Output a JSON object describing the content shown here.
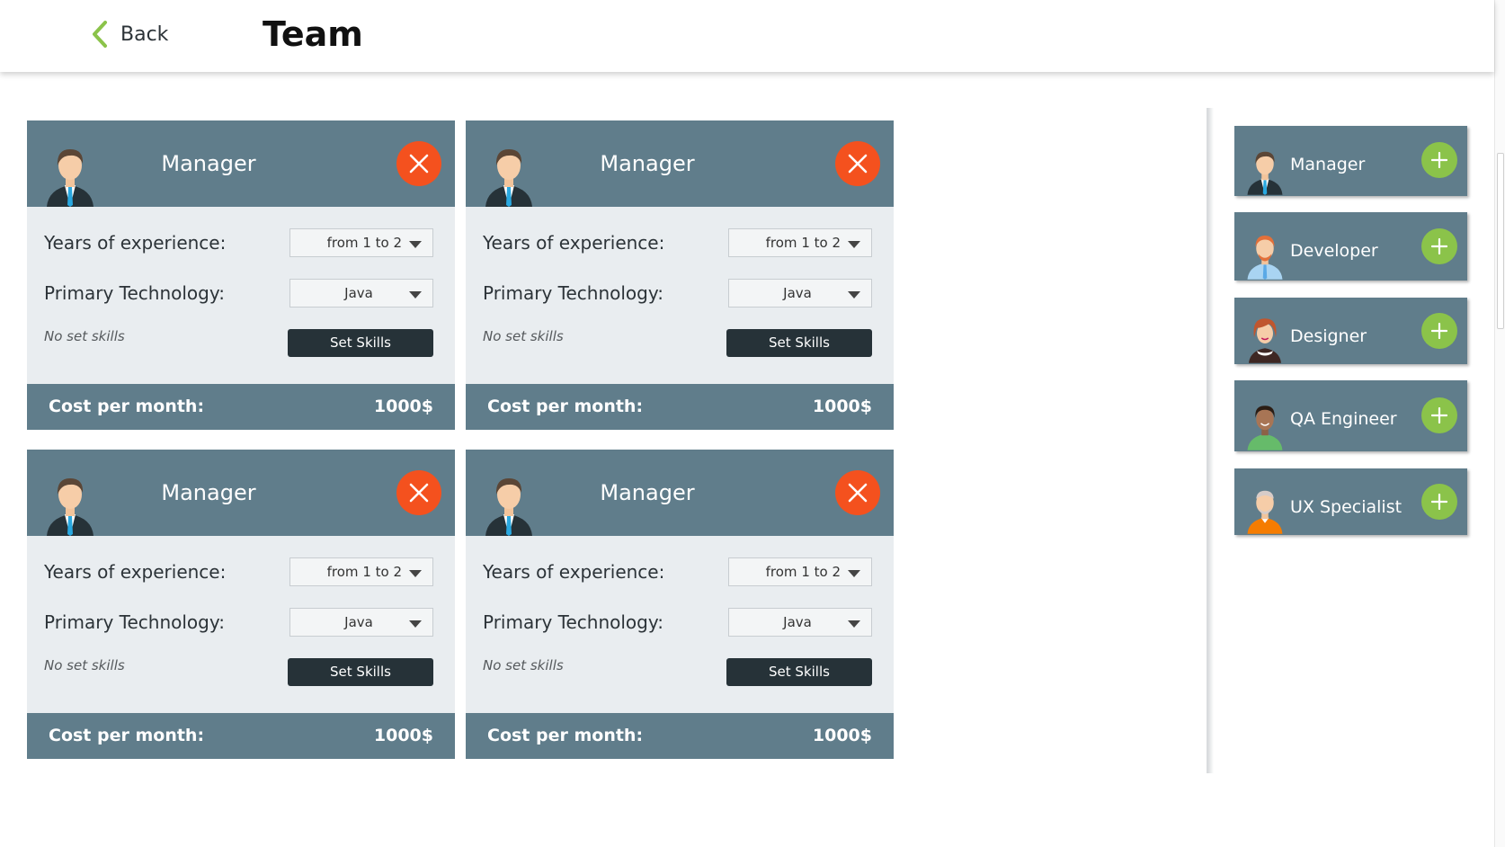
{
  "header": {
    "back_label": "Back",
    "title": "Team"
  },
  "labels": {
    "experience": "Years of experience:",
    "technology": "Primary Technology:",
    "no_skills": "No set skills",
    "set_skills": "Set Skills",
    "cost_label": "Cost per month:"
  },
  "cards": [
    {
      "role": "Manager",
      "experience": "from 1 to 2",
      "technology": "Java",
      "cost": "1000$"
    },
    {
      "role": "Manager",
      "experience": "from 1 to 2",
      "technology": "Java",
      "cost": "1000$"
    },
    {
      "role": "Manager",
      "experience": "from 1 to 2",
      "technology": "Java",
      "cost": "1000$"
    },
    {
      "role": "Manager",
      "experience": "from 1 to 2",
      "technology": "Java",
      "cost": "1000$"
    }
  ],
  "roles": [
    {
      "label": "Manager",
      "icon": "manager-avatar-icon"
    },
    {
      "label": "Developer",
      "icon": "developer-avatar-icon"
    },
    {
      "label": "Designer",
      "icon": "designer-avatar-icon"
    },
    {
      "label": "QA Engineer",
      "icon": "qa-engineer-avatar-icon"
    },
    {
      "label": "UX Specialist",
      "icon": "ux-specialist-avatar-icon"
    }
  ],
  "colors": {
    "card_header": "#607d8b",
    "remove_button": "#f4511e",
    "add_button": "#8bc34a",
    "back_chevron": "#8bc34a",
    "set_skills_button": "#263238"
  }
}
